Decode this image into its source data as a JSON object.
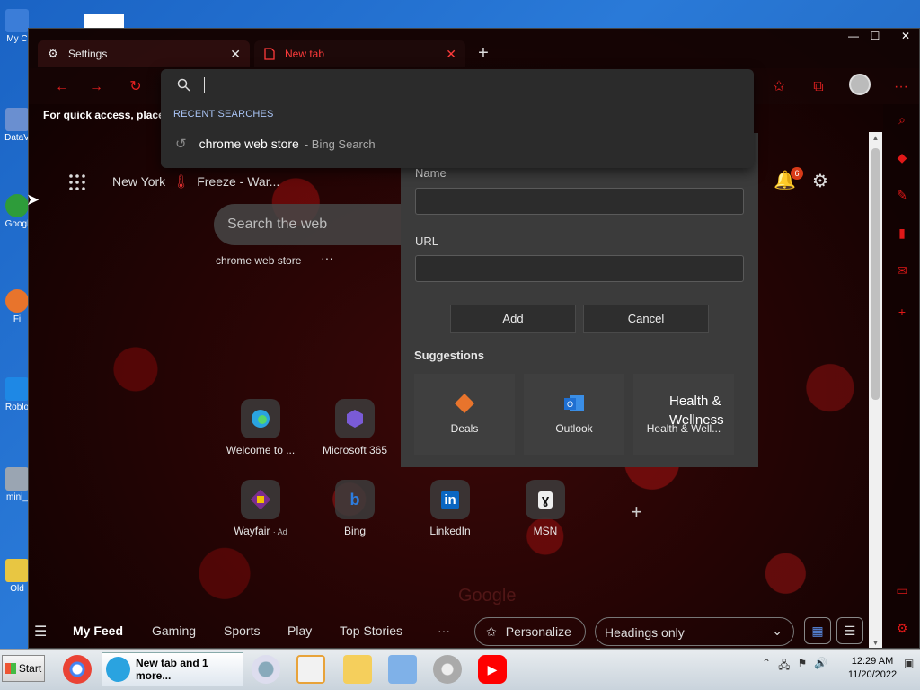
{
  "desktop": {
    "icons": [
      {
        "label": "My C",
        "color": "#3b7dd8"
      },
      {
        "label": "DataV",
        "color": "#6a8fd0"
      },
      {
        "label": "Googl",
        "color": "#2e9c3a"
      },
      {
        "label": "Fi",
        "color": "#e8742c"
      },
      {
        "label": "Roblo",
        "color": "#1e88e5"
      },
      {
        "label": "mini_",
        "color": "#9aa5b2"
      },
      {
        "label": "Old",
        "color": "#e8c642"
      }
    ]
  },
  "browser": {
    "tabs": [
      {
        "label": "Settings",
        "icon": "gear-icon"
      },
      {
        "label": "New tab",
        "icon": "page-icon"
      }
    ],
    "new_tab_symbol": "+",
    "window_controls": {
      "minimize": "—",
      "maximize": "☐",
      "close": "✕"
    },
    "toolbar": {
      "more": "···"
    },
    "quick_access_text": "For quick access, place y",
    "accent": "#e01818"
  },
  "omnibox": {
    "value": "",
    "recent_label": "RECENT SEARCHES",
    "results": [
      {
        "query": "chrome web store",
        "source": "- Bing Search"
      }
    ]
  },
  "ntp": {
    "weather_location": "New York",
    "weather_alert": "Freeze - War...",
    "notification_count": "6",
    "search_placeholder": "Search the web",
    "recent_search_chip": "chrome web store",
    "recent_more": "···",
    "quick_links": [
      {
        "label": "Welcome to ...",
        "icon": "edge-icon",
        "color": "#2aa3e0"
      },
      {
        "label": "Microsoft 365",
        "icon": "microsoft-365-icon",
        "color": "#7a5bd6"
      },
      {
        "label": "Wayfair",
        "ad": "· Ad",
        "icon": "wayfair-icon",
        "color": "#7b2d8e"
      },
      {
        "label": "Bing",
        "icon": "bing-icon",
        "color": "#2d7de0"
      },
      {
        "label": "LinkedIn",
        "icon": "linkedin-icon",
        "color": "#0a66c2"
      },
      {
        "label": "MSN",
        "icon": "msn-icon",
        "color": "#222222"
      }
    ],
    "add_link": "+",
    "ghost_text": "Google"
  },
  "feed": {
    "items": [
      "My Feed",
      "Gaming",
      "Sports",
      "Play",
      "Top Stories"
    ],
    "more": "···",
    "personalize": "Personalize",
    "headings": "Headings only"
  },
  "dialog": {
    "name_label": "Name",
    "name_value": "",
    "url_label": "URL",
    "url_value": "",
    "add": "Add",
    "cancel": "Cancel",
    "suggestions_title": "Suggestions",
    "suggestions": [
      {
        "label": "Deals",
        "icon": "deals-tag-icon",
        "color": "#e8742c"
      },
      {
        "label": "Outlook",
        "icon": "outlook-icon",
        "color": "#1f6fd1"
      },
      {
        "label": "Health & Well...",
        "icon": "broken-image-icon",
        "alt": "Health & Wellness"
      }
    ]
  },
  "taskbar": {
    "start": "Start",
    "active_window": "New tab and 1 more...",
    "time": "12:29 AM",
    "date": "11/20/2022"
  }
}
